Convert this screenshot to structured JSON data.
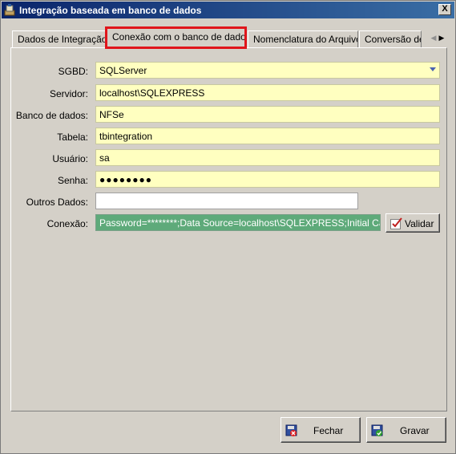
{
  "window": {
    "title": "Integração baseada em banco de dados",
    "close_label": "X"
  },
  "tabs": [
    {
      "label": "Dados de Integração"
    },
    {
      "label": "Conexão com o banco de dados"
    },
    {
      "label": "Nomenclatura do Arquivo"
    },
    {
      "label": "Conversão de"
    }
  ],
  "tab_nav": {
    "prev": "◀",
    "next": "▶"
  },
  "form": {
    "sgbd": {
      "label": "SGBD:",
      "value": "SQLServer"
    },
    "servidor": {
      "label": "Servidor:",
      "value": "localhost\\SQLEXPRESS"
    },
    "banco": {
      "label": "Banco de dados:",
      "value": "NFSe"
    },
    "tabela": {
      "label": "Tabela:",
      "value": "tbintegration"
    },
    "usuario": {
      "label": "Usuário:",
      "value": "sa"
    },
    "senha": {
      "label": "Senha:",
      "value": "●●●●●●●●"
    },
    "outros": {
      "label": "Outros Dados:",
      "value": ""
    },
    "conexao": {
      "label": "Conexão:",
      "value": "Password=********;Data Source=localhost\\SQLEXPRESS;Initial Catalog=N"
    }
  },
  "buttons": {
    "validar": "Validar",
    "fechar": "Fechar",
    "gravar": "Gravar"
  },
  "colors": {
    "title_start": "#0a246a",
    "title_end": "#3a6ea5",
    "field_yellow": "#ffffc0",
    "connection_green": "#5eaa7a",
    "active_tab_outline": "#e0151b"
  }
}
